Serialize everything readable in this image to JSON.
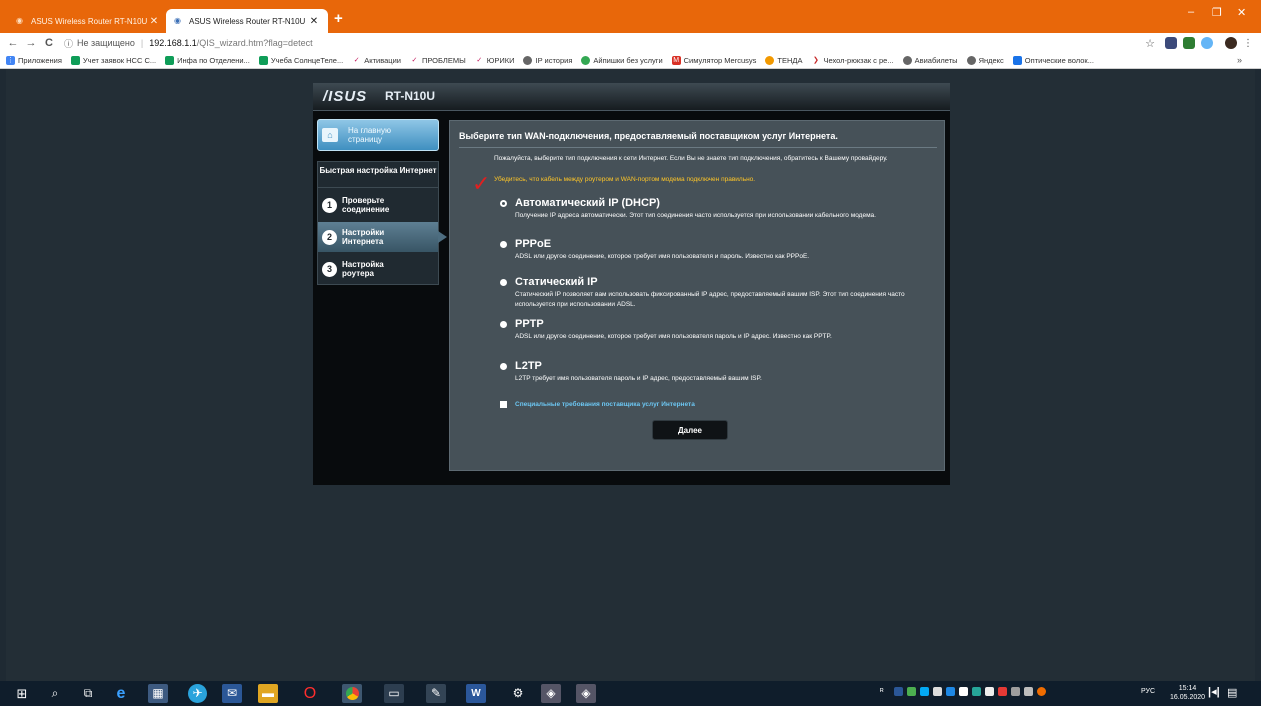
{
  "browser": {
    "tabs": [
      {
        "title": "ASUS Wireless Router RT-N10U",
        "active": false
      },
      {
        "title": "ASUS Wireless Router RT-N10U",
        "active": true
      }
    ],
    "new_tab": "+",
    "window_controls": {
      "minimize": "–",
      "restore": "❐",
      "close": "✕"
    },
    "nav": {
      "back": "←",
      "forward": "→",
      "reload": "C"
    },
    "address": {
      "security_label": "Не защищено",
      "host": "192.168.1.1",
      "path": "/QIS_wizard.htm?flag=detect"
    },
    "toolbar_icons": [
      "star-icon",
      "extension-icon",
      "extension-icon-2",
      "extension-icon-3",
      "profile-icon",
      "menu-icon"
    ],
    "bookmarks": [
      {
        "label": "Приложения",
        "color": "#4285f4"
      },
      {
        "label": "Учет заявок НСС С...",
        "color": "#0f9d58"
      },
      {
        "label": "Инфа по Отделени...",
        "color": "#0f9d58"
      },
      {
        "label": "Учеба СолнцеТеле...",
        "color": "#0f9d58"
      },
      {
        "label": "Активации",
        "color": "#c2185b"
      },
      {
        "label": "ПРОБЛЕМЫ",
        "color": "#c2185b"
      },
      {
        "label": "ЮРИКИ",
        "color": "#c2185b"
      },
      {
        "label": "IP история",
        "color": "#666666"
      },
      {
        "label": "Айпишки без услуги",
        "color": "#34a853"
      },
      {
        "label": "Симулятор Mercusys",
        "color": "#d93025"
      },
      {
        "label": "ТЕНДА",
        "color": "#f29900"
      },
      {
        "label": "Чехол-рюкзак с ре...",
        "color": "#c62828"
      },
      {
        "label": "Авиабилеты",
        "color": "#666666"
      },
      {
        "label": "Яндекс",
        "color": "#666666"
      },
      {
        "label": "Оптические волок...",
        "color": "#1a73e8"
      }
    ],
    "bookmarks_overflow": "»"
  },
  "router": {
    "logo": "/ISUS",
    "model": "RT-N10U",
    "sidebar": {
      "home_label": "На главную страницу",
      "qis_title": "Быстрая настройка Интернет",
      "steps": [
        {
          "num": "1",
          "label": "Проверьте соединение",
          "active": false
        },
        {
          "num": "2",
          "label": "Настройки Интернета",
          "active": true
        },
        {
          "num": "3",
          "label": "Настройка роутера",
          "active": false
        }
      ]
    },
    "content": {
      "title": "Выберите тип WAN-подключения, предоставляемый поставщиком услуг Интернета.",
      "intro": "Пожалуйста, выберите тип подключения к сети Интернет. Если Вы не знаете тип подключения, обратитесь к Вашему провайдеру.",
      "warning": "Убедитесь, что кабель между роутером и WAN-портом модема подключен правильно.",
      "checkmark": "✓",
      "options": [
        {
          "name": "Автоматический IP (DHCP)",
          "desc": "Получение IP адреса автоматически. Этот тип соединения часто используется при использовании кабельного модема.",
          "selected": true
        },
        {
          "name": "PPPoE",
          "desc": "ADSL или другое соединение, которое требует имя пользователя и пароль. Известно как PPPoE.",
          "selected": false
        },
        {
          "name": "Статический IP",
          "desc": "Статический IP позволяет вам использовать фиксированный IP адрес, предоставляемый вашим ISP. Этот тип соединения часто используется при использовании ADSL.",
          "selected": false
        },
        {
          "name": "PPTP",
          "desc": "ADSL или другое соединение, которое требует имя пользователя пароль и IP адрес. Известно как PPTP.",
          "selected": false
        },
        {
          "name": "L2TP",
          "desc": "L2TP требует имя пользователя пароль и IP адрес, предоставляемый вашим ISP.",
          "selected": false
        }
      ],
      "special_label": "Специальные требования поставщика услуг Интернета",
      "next_label": "Далее"
    }
  },
  "taskbar": {
    "language": "РУС",
    "time": "15:14",
    "date": "16.05.2020"
  }
}
